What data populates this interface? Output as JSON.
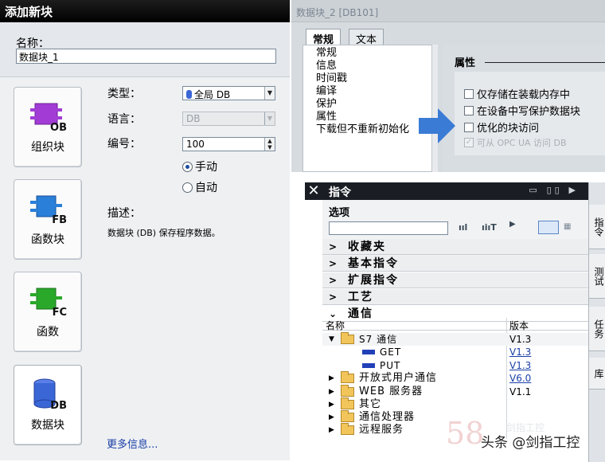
{
  "add_block": {
    "title": "添加新块",
    "name_label": "名称：",
    "name_value": "数据块_1",
    "blocks": [
      {
        "label": "组织块",
        "tag": "OB",
        "color": "#a23bd6"
      },
      {
        "label": "函数块",
        "tag": "FB",
        "color": "#2a7fd8"
      },
      {
        "label": "函数",
        "tag": "FC",
        "color": "#2aa82a"
      },
      {
        "label": "数据块",
        "tag": "DB",
        "color": "#3a66d6"
      }
    ],
    "type_label": "类型：",
    "type_value": "全局 DB",
    "lang_label": "语言：",
    "lang_value": "DB",
    "number_label": "编号：",
    "number_value": "100",
    "radio_manual": "手动",
    "radio_auto": "自动",
    "desc_label": "描述：",
    "desc_text": "数据块 (DB) 保存程序数据。",
    "more_info": "更多信息..."
  },
  "db_props": {
    "title": "数据块_2 [DB101]",
    "tabs": [
      "常规",
      "文本"
    ],
    "nav": [
      "常规",
      "信息",
      "时间戳",
      "编译",
      "保护",
      "属性",
      "下载但不重新初始化"
    ],
    "section_title": "属性",
    "options": [
      {
        "label": "仅存储在装载内存中",
        "checked": false,
        "disabled": false
      },
      {
        "label": "在设备中写保护数据块",
        "checked": false,
        "disabled": false
      },
      {
        "label": "优化的块访问",
        "checked": false,
        "disabled": false
      },
      {
        "label": "可从 OPC UA 访问 DB",
        "checked": true,
        "disabled": true
      }
    ]
  },
  "instructions": {
    "title": "指令",
    "options_label": "选项",
    "sections": [
      "收藏夹",
      "基本指令",
      "扩展指令",
      "工艺",
      "通信"
    ],
    "col_name": "名称",
    "col_version": "版本",
    "rows": [
      {
        "name": "S7 通信",
        "version": "V1.3",
        "kind": "folder",
        "expanded": true,
        "indent": 0,
        "link": false
      },
      {
        "name": "GET",
        "version": "V1.3",
        "kind": "instr",
        "indent": 1,
        "link": true
      },
      {
        "name": "PUT",
        "version": "V1.3",
        "kind": "instr",
        "indent": 1,
        "link": true
      },
      {
        "name": "开放式用户通信",
        "version": "V6.0",
        "kind": "folder",
        "indent": 0,
        "link": true
      },
      {
        "name": "WEB 服务器",
        "version": "V1.1",
        "kind": "folder",
        "indent": 0,
        "link": false
      },
      {
        "name": "其它",
        "version": "",
        "kind": "folder",
        "indent": 0,
        "link": false
      },
      {
        "name": "通信处理器",
        "version": "",
        "kind": "folder",
        "indent": 0,
        "link": false
      },
      {
        "name": "远程服务",
        "version": "",
        "kind": "folder",
        "indent": 0,
        "link": false
      }
    ],
    "side_tabs": [
      "指令",
      "测试",
      "任务",
      "库"
    ]
  },
  "watermark": "58",
  "brand": "头条 @剑指工控",
  "brand_faint": "剑指工控"
}
